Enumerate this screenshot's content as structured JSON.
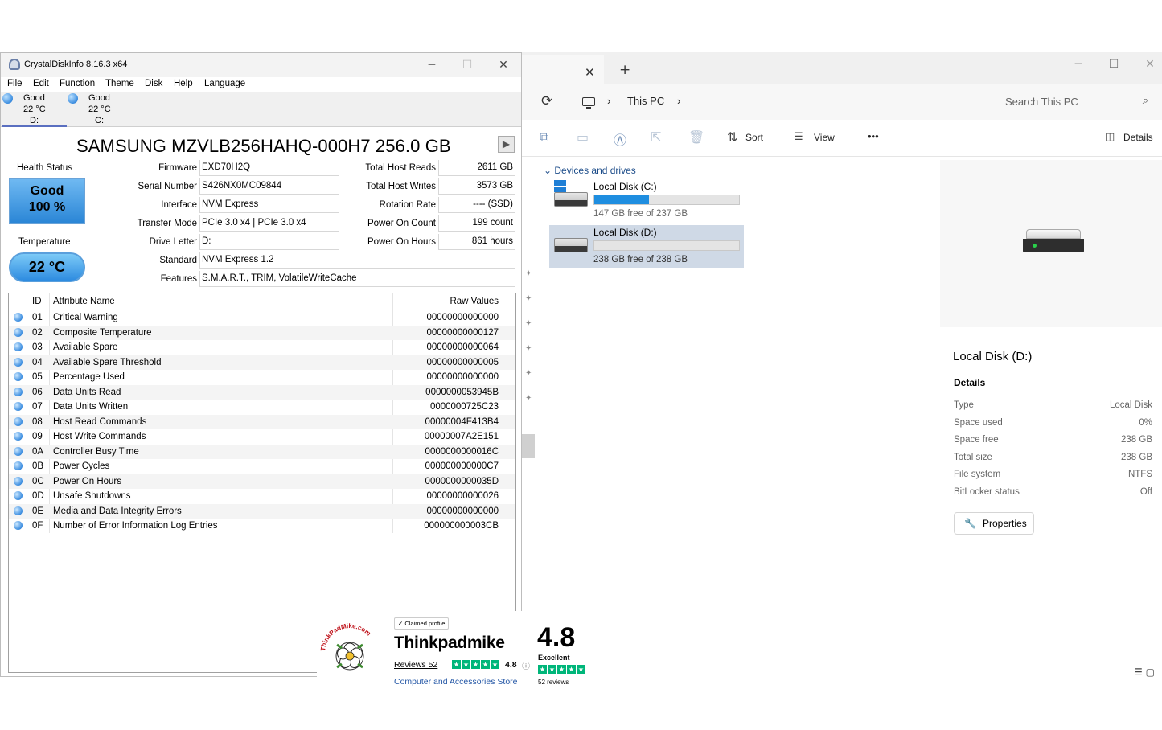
{
  "crystaldiskinfo": {
    "title": "CrystalDiskInfo 8.16.3 x64",
    "window_controls": {
      "minimize": "─",
      "maximize": "☐",
      "close": "✕"
    },
    "menu": [
      "File",
      "Edit",
      "Function",
      "Theme",
      "Disk",
      "Help",
      "Language"
    ],
    "disk_tabs": [
      {
        "status": "Good",
        "temp": "22 °C",
        "letter": "D:"
      },
      {
        "status": "Good",
        "temp": "22 °C",
        "letter": "C:"
      }
    ],
    "model": "SAMSUNG MZVLB256HAHQ-000H7 256.0 GB",
    "health": {
      "label": "Health Status",
      "status": "Good",
      "percent": "100 %"
    },
    "temperature": {
      "label": "Temperature",
      "value": "22 °C"
    },
    "info_left": [
      {
        "label": "Firmware",
        "value": "EXD70H2Q"
      },
      {
        "label": "Serial Number",
        "value": "S426NX0MC09844"
      },
      {
        "label": "Interface",
        "value": "NVM Express"
      },
      {
        "label": "Transfer Mode",
        "value": "PCIe 3.0 x4 | PCIe 3.0 x4"
      },
      {
        "label": "Drive Letter",
        "value": "D:"
      }
    ],
    "info_right": [
      {
        "label": "Total Host Reads",
        "value": "2611 GB"
      },
      {
        "label": "Total Host Writes",
        "value": "3573 GB"
      },
      {
        "label": "Rotation Rate",
        "value": "---- (SSD)"
      },
      {
        "label": "Power On Count",
        "value": "199 count"
      },
      {
        "label": "Power On Hours",
        "value": "861 hours"
      }
    ],
    "standard": {
      "label": "Standard",
      "value": "NVM Express 1.2"
    },
    "features": {
      "label": "Features",
      "value": "S.M.A.R.T., TRIM, VolatileWriteCache"
    },
    "table": {
      "headers": {
        "id": "ID",
        "name": "Attribute Name",
        "raw": "Raw Values"
      },
      "rows": [
        {
          "id": "01",
          "name": "Critical Warning",
          "raw": "00000000000000"
        },
        {
          "id": "02",
          "name": "Composite Temperature",
          "raw": "00000000000127"
        },
        {
          "id": "03",
          "name": "Available Spare",
          "raw": "00000000000064"
        },
        {
          "id": "04",
          "name": "Available Spare Threshold",
          "raw": "00000000000005"
        },
        {
          "id": "05",
          "name": "Percentage Used",
          "raw": "00000000000000"
        },
        {
          "id": "06",
          "name": "Data Units Read",
          "raw": "0000000053945B"
        },
        {
          "id": "07",
          "name": "Data Units Written",
          "raw": "0000000725C23"
        },
        {
          "id": "08",
          "name": "Host Read Commands",
          "raw": "00000004F413B4"
        },
        {
          "id": "09",
          "name": "Host Write Commands",
          "raw": "00000007A2E151"
        },
        {
          "id": "0A",
          "name": "Controller Busy Time",
          "raw": "0000000000016C"
        },
        {
          "id": "0B",
          "name": "Power Cycles",
          "raw": "000000000000C7"
        },
        {
          "id": "0C",
          "name": "Power On Hours",
          "raw": "0000000000035D"
        },
        {
          "id": "0D",
          "name": "Unsafe Shutdowns",
          "raw": "00000000000026"
        },
        {
          "id": "0E",
          "name": "Media and Data Integrity Errors",
          "raw": "00000000000000"
        },
        {
          "id": "0F",
          "name": "Number of Error Information Log Entries",
          "raw": "000000000003CB"
        }
      ]
    }
  },
  "explorer": {
    "tab_close": "✕",
    "tab_add": "+",
    "window_controls": {
      "minimize": "─",
      "maximize": "☐",
      "close": "✕"
    },
    "refresh_icon": "⟳",
    "breadcrumb": {
      "sep": "›",
      "location": "This PC"
    },
    "search_placeholder": "Search This PC",
    "search_icon": "⌕",
    "commands": {
      "sort": "Sort",
      "view": "View",
      "more": "•••",
      "details": "Details"
    },
    "group_label": "Devices and drives",
    "drives": [
      {
        "name": "Local Disk (C:)",
        "free": "147 GB free of 237 GB",
        "used_fraction": 0.38
      },
      {
        "name": "Local Disk (D:)",
        "free": "238 GB free of 238 GB",
        "used_fraction": 0.0
      }
    ],
    "details_pane": {
      "title": "Local Disk (D:)",
      "section": "Details",
      "rows": [
        {
          "key": "Type",
          "value": "Local Disk"
        },
        {
          "key": "Space used",
          "value": "0%"
        },
        {
          "key": "Space free",
          "value": "238 GB"
        },
        {
          "key": "Total size",
          "value": "238 GB"
        },
        {
          "key": "File system",
          "value": "NTFS"
        },
        {
          "key": "BitLocker status",
          "value": "Off"
        }
      ],
      "properties_button": "Properties"
    }
  },
  "trustpilot_badge": {
    "logo_text": "ThinkPadMike.com",
    "claimed": "Claimed profile",
    "business_name": "Thinkpadmike",
    "reviews_link": "Reviews 52",
    "rating_small": "4.8",
    "category": "Computer and Accessories Store",
    "rating_big": "4.8",
    "rating_word": "Excellent",
    "review_count": "52 reviews",
    "star_color": "#00b67a"
  }
}
